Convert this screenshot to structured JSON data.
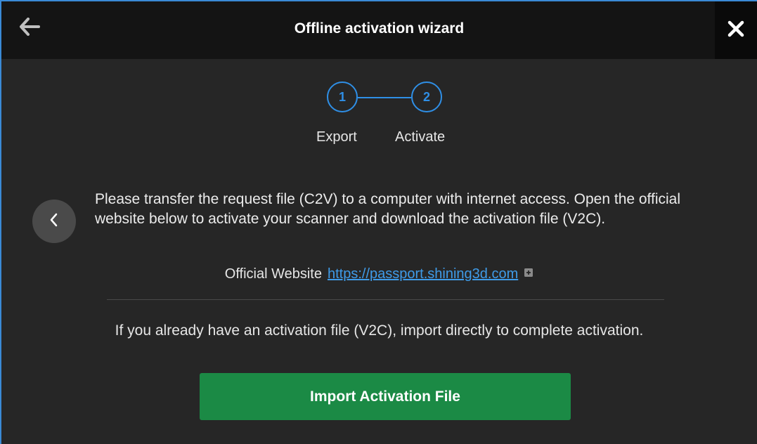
{
  "header": {
    "title": "Offline activation wizard",
    "back_icon": "arrow-left-icon",
    "close_icon": "close-icon"
  },
  "stepper": {
    "steps": [
      {
        "number": "1",
        "label": "Export"
      },
      {
        "number": "2",
        "label": "Activate"
      }
    ],
    "accent_color": "#2f8fe6"
  },
  "instructions": {
    "text": "Please transfer the request file (C2V) to a computer with internet access. Open the official website below to activate your scanner and download the activation file (V2C)."
  },
  "website": {
    "label": "Official Website",
    "url": "https://passport.shining3d.com",
    "copy_icon": "copy-icon"
  },
  "import_hint": "If you already have an activation file (V2C), import directly to complete activation.",
  "import_button": {
    "label": "Import Activation File",
    "color": "#1b8a45"
  },
  "nav": {
    "prev_icon": "chevron-left-icon"
  }
}
